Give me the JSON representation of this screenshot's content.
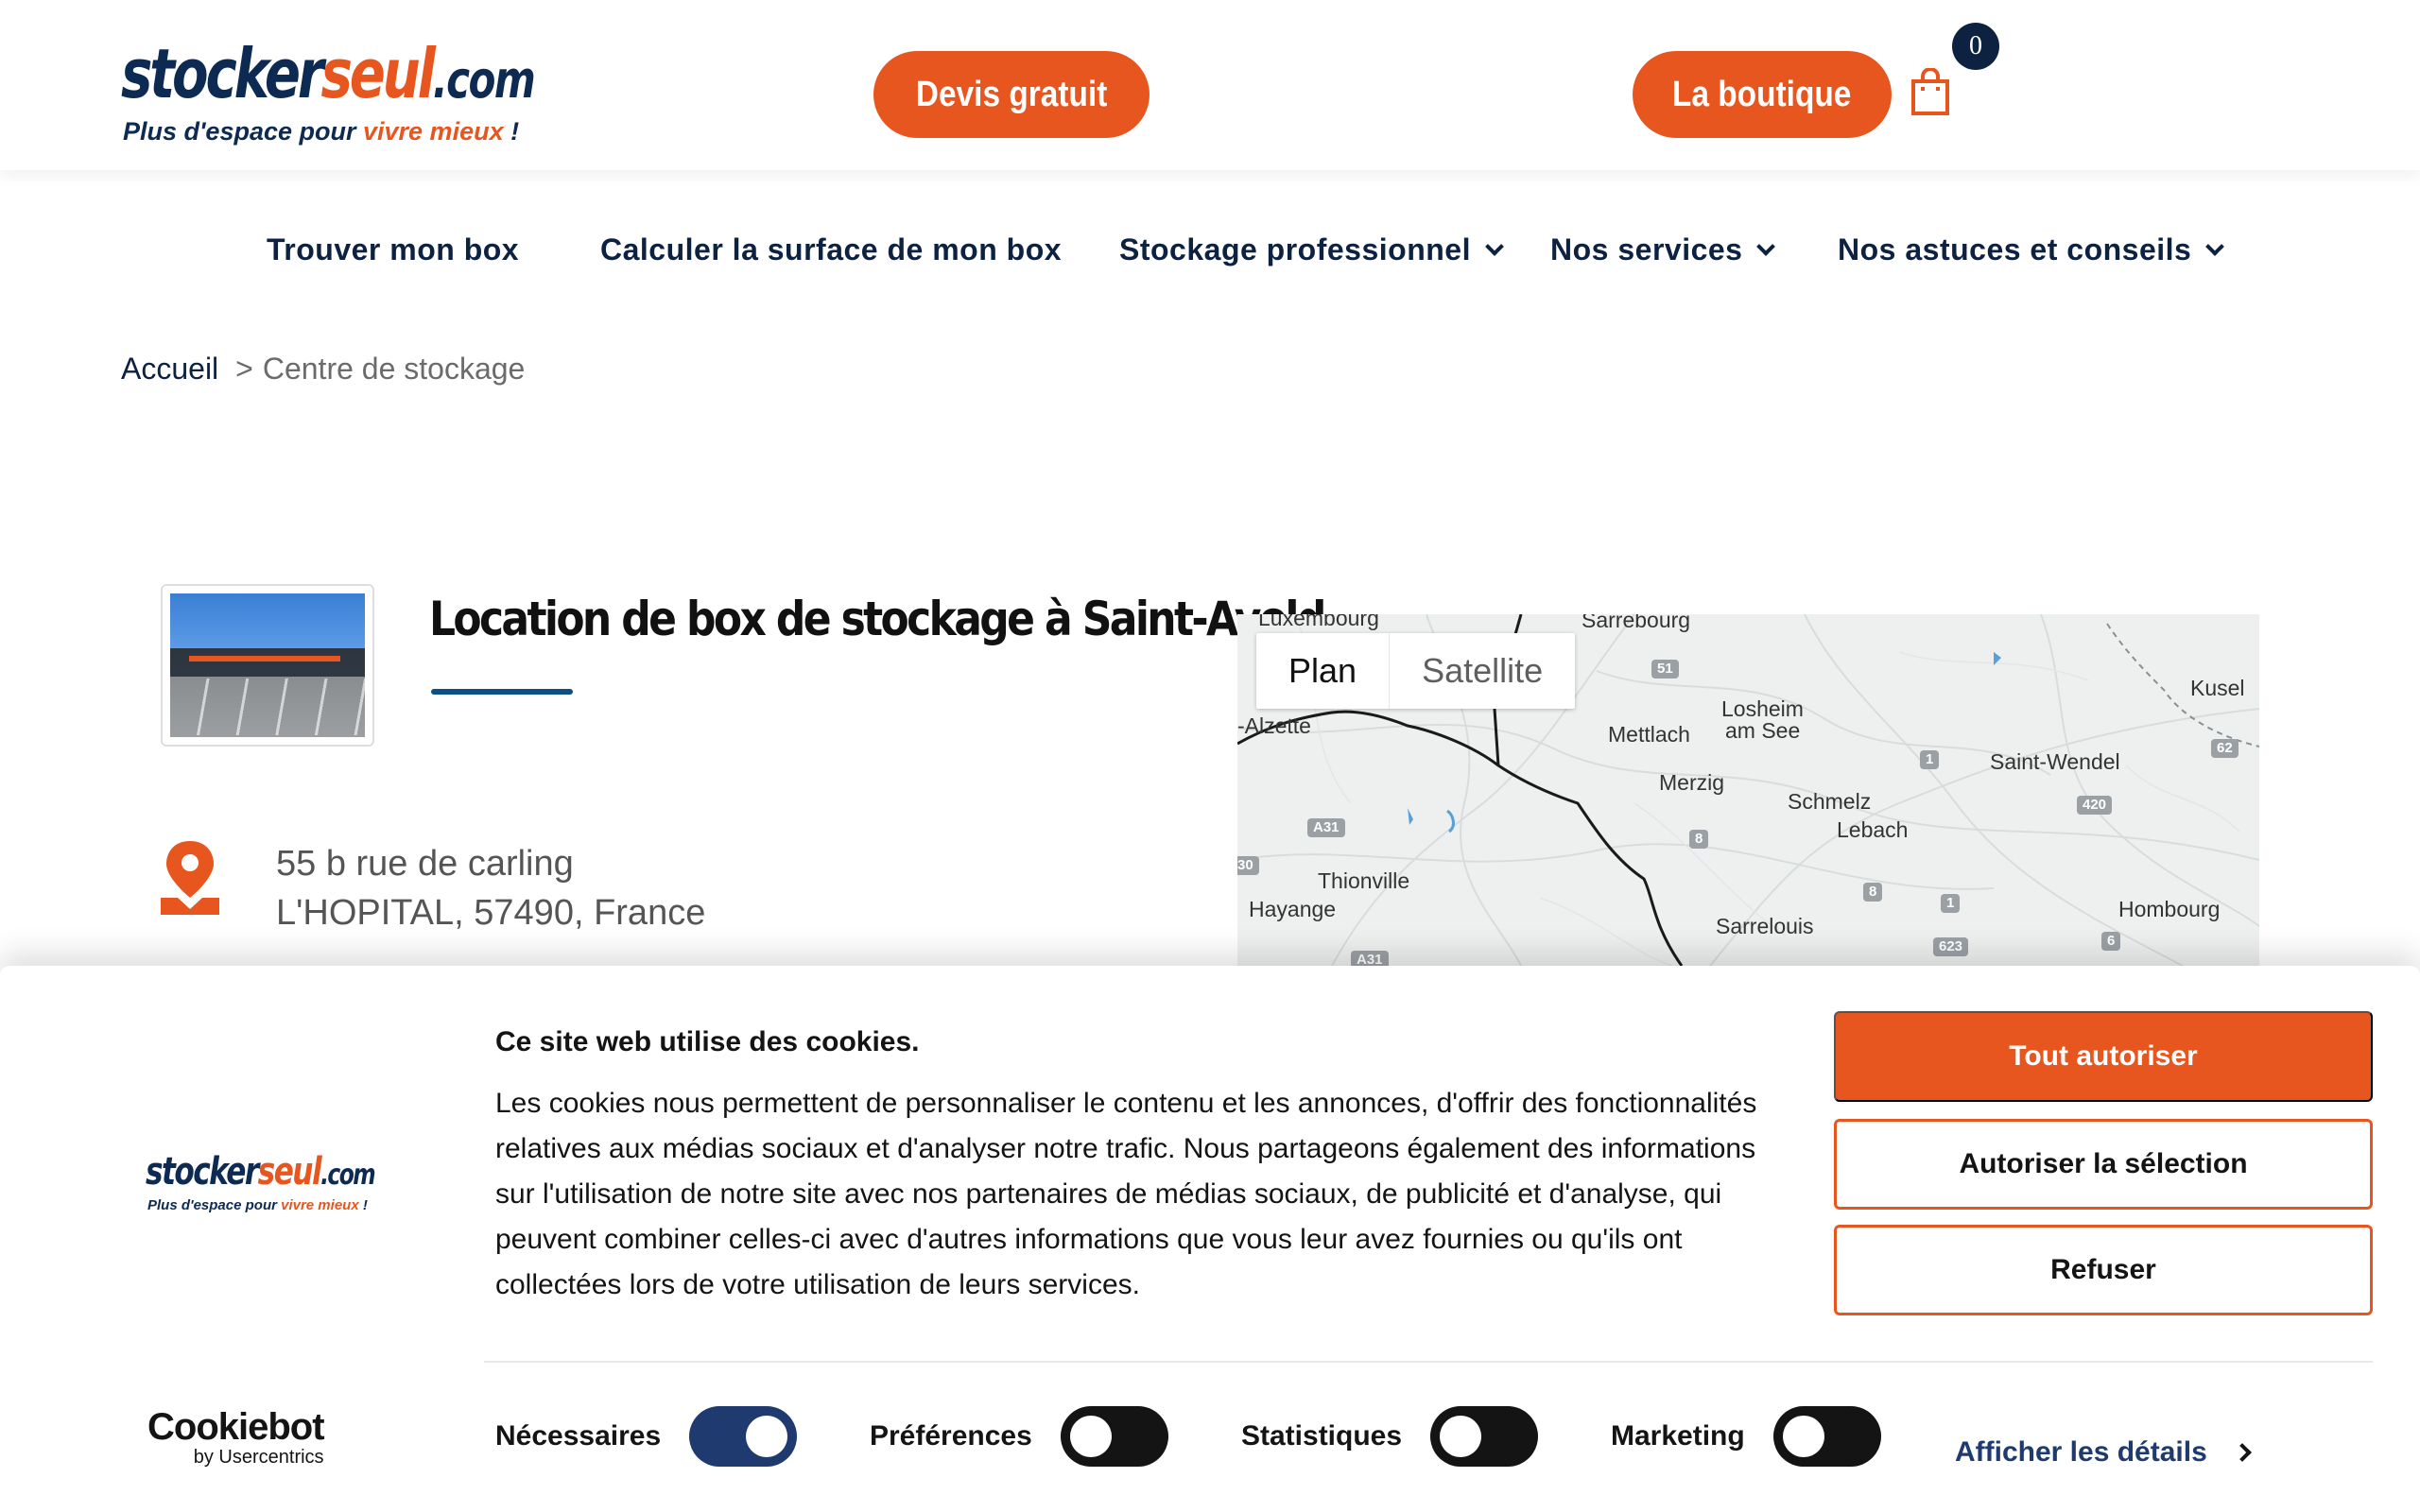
{
  "header": {
    "logo": {
      "brand_main": "stocker",
      "brand_accent": "seul",
      "brand_suffix": ".com",
      "tagline_start": "Plus d'espace pour ",
      "tagline_accent": "vivre mieux",
      "tagline_end": " !"
    },
    "devis_label": "Devis gratuit",
    "boutique_label": "La boutique",
    "cart_count": "0"
  },
  "nav": {
    "items": [
      {
        "label": "Trouver mon box"
      },
      {
        "label": "Calculer la surface de mon box"
      },
      {
        "label": "Stockage professionnel"
      },
      {
        "label": "Nos services"
      },
      {
        "label": "Nos astuces et conseils"
      }
    ]
  },
  "breadcrumb": {
    "home": "Accueil",
    "separator": ">",
    "current": "Centre de stockage"
  },
  "center": {
    "title": "Location de box de stockage à Saint-Avold",
    "address_line1": "55 b rue de carling",
    "address_line2": "L'HOPITAL, 57490, France"
  },
  "map": {
    "plan_label": "Plan",
    "satellite_label": "Satellite",
    "places": [
      "Luxembourg",
      "Sarrebourg",
      "Kusel",
      "Losheim",
      "am See",
      "Mettlach",
      "-Alzette",
      "Saint-Wendel",
      "Merzig",
      "Schmelz",
      "Lebach",
      "Thionville",
      "Hayange",
      "Sarrelouis",
      "Hombourg"
    ],
    "shields": [
      "51",
      "1",
      "62",
      "A31",
      "420",
      "8",
      "30",
      "8",
      "1",
      "623",
      "6",
      "A31"
    ]
  },
  "cookie": {
    "title": "Ce site web utilise des cookies.",
    "text": "Les cookies nous permettent de personnaliser le contenu et les annonces, d'offrir des fonctionnalités relatives aux médias sociaux et d'analyser notre trafic. Nous partageons également des informations sur l'utilisation de notre site avec nos partenaires de médias sociaux, de publicité et d'analyse, qui peuvent combiner celles-ci avec d'autres informations que vous leur avez fournies ou qu'ils ont collectées lors de votre utilisation de leurs services.",
    "allow_all": "Tout autoriser",
    "allow_selection": "Autoriser la sélection",
    "refuse": "Refuser",
    "toggles": [
      {
        "label": "Nécessaires",
        "on": true
      },
      {
        "label": "Préférences",
        "on": false
      },
      {
        "label": "Statistiques",
        "on": false
      },
      {
        "label": "Marketing",
        "on": false
      }
    ],
    "details_label": "Afficher les détails",
    "cookiebot_main": "Cookiebot",
    "cookiebot_sub": "by Usercentrics"
  },
  "colors": {
    "brand_orange": "#e8561f",
    "brand_navy": "#0d2241",
    "toggle_on": "#1e3a6e"
  }
}
